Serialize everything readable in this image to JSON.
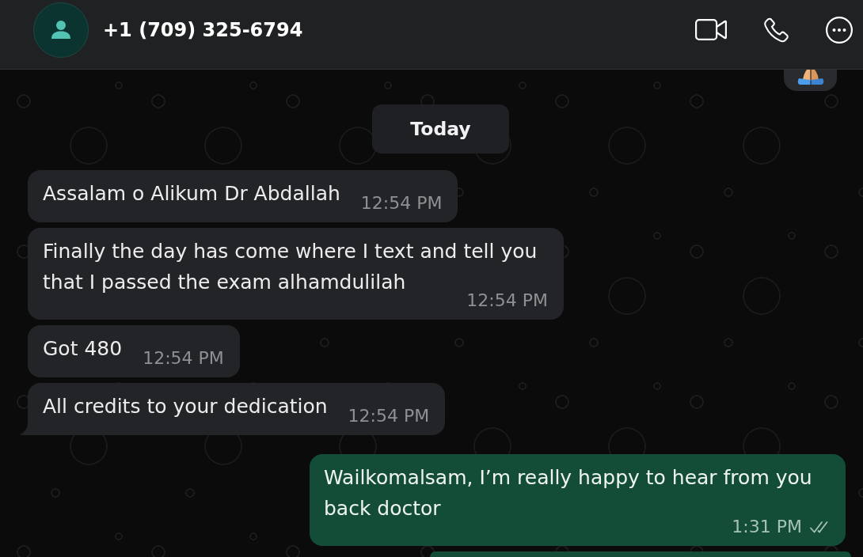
{
  "header": {
    "contact_name": "+1 (709) 325-6794"
  },
  "date_divider": "Today",
  "messages": [
    {
      "kind": "incoming",
      "text": "Assalam o Alikum Dr Abdallah",
      "time": "12:54 PM",
      "tail": false
    },
    {
      "kind": "incoming",
      "text": "Finally the day has come where I text and tell you that I passed the exam alhamdulilah",
      "time": "12:54 PM",
      "tail": false
    },
    {
      "kind": "incoming",
      "text": "Got 480",
      "time": "12:54 PM",
      "tail": false
    },
    {
      "kind": "incoming",
      "text": "All credits to your dedication",
      "time": "12:54 PM",
      "tail": true
    },
    {
      "kind": "outgoing",
      "text": "Wailkomalsam, I’m really happy to hear from you back doctor",
      "time": "1:31 PM",
      "tail": false,
      "read": false
    }
  ]
}
